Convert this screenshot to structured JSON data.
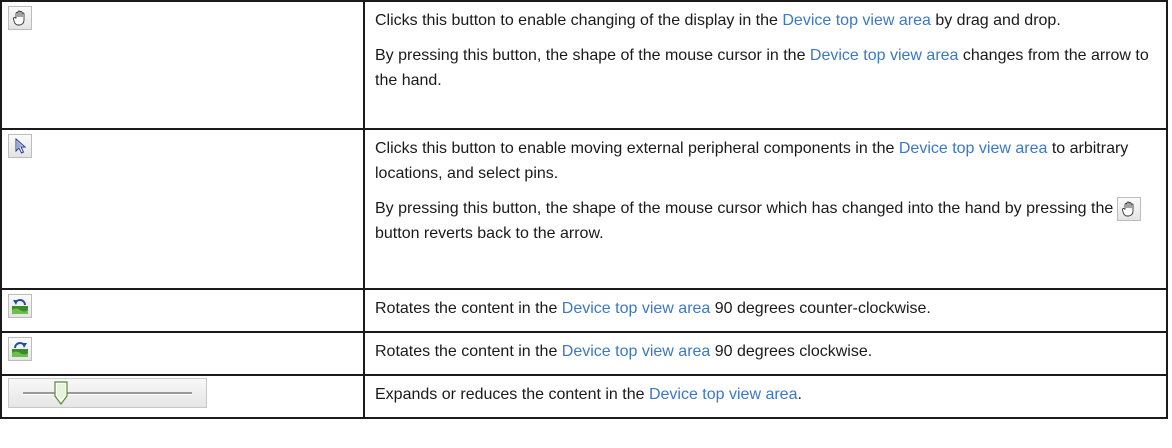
{
  "rows": [
    {
      "icon": "hand-pan-icon",
      "paragraphs": [
        {
          "before": "Clicks this button to enable changing of the display in the ",
          "link": "Device top view area",
          "after": " by drag and drop."
        },
        {
          "before": "By pressing this button, the shape of the mouse cursor in the ",
          "link": "Device top view area",
          "after": " changes from the arrow to the hand."
        }
      ]
    },
    {
      "icon": "arrow-select-icon",
      "paragraphs": [
        {
          "before": "Clicks this button to enable moving external peripheral components in the ",
          "link": "Device top view area",
          "after": " to arbitrary locations, and select pins."
        },
        {
          "before": "By pressing this button, the shape of the mouse cursor which has changed into the hand by pressing the",
          "inline_icon": "hand-pan-icon",
          "after": "button reverts back to the arrow."
        }
      ]
    },
    {
      "icon": "rotate-counter-clockwise-icon",
      "paragraphs": [
        {
          "before": "Rotates the content in the ",
          "link": "Device top view area",
          "after": " 90 degrees counter-clockwise."
        }
      ]
    },
    {
      "icon": "rotate-clockwise-icon",
      "paragraphs": [
        {
          "before": "Rotates the content in the ",
          "link": "Device top view area",
          "after": " 90 degrees clockwise."
        }
      ]
    },
    {
      "icon": "zoom-slider",
      "slider_level": 0.22,
      "paragraphs": [
        {
          "before": "Expands or reduces the content in the ",
          "link": "Device top view area",
          "after": "."
        }
      ]
    }
  ],
  "colors": {
    "link": "#3a78c8",
    "border": "#1a1a1a",
    "text": "#1a1a1a"
  }
}
